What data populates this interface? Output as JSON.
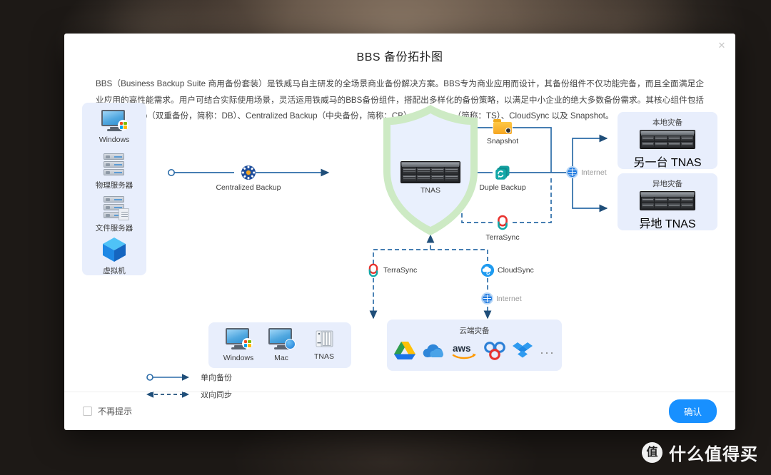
{
  "watermark": {
    "badge": "值",
    "text": "什么值得买"
  },
  "dialog": {
    "title": "BBS 备份拓扑图",
    "close_icon": "close-icon",
    "description": "BBS（Business Backup Suite 商用备份套装）是铁威马自主研发的全场景商业备份解决方案。BBS专为商业应用而设计，其备份组件不仅功能完备，而且全面满足企业应用的高性能需求。用户可结合实际使用场景，灵活运用铁威马的BBS备份组件，搭配出多样化的备份策略，以满足中小企业的绝大多数备份需求。其核心组件包括Duple Backup（双重备份，简称：DB）、Centralized Backup（中央备份，简称：CB）、TerraSync（简称：TS）、CloudSync 以及 Snapshot。"
  },
  "diagram": {
    "sources": [
      {
        "label": "Windows",
        "icon": "windows-monitor-icon"
      },
      {
        "label": "物理服务器",
        "icon": "physical-server-icon"
      },
      {
        "label": "文件服务器",
        "icon": "file-server-icon"
      },
      {
        "label": "虚拟机",
        "icon": "virtual-machine-cube-icon"
      }
    ],
    "centralized_backup": {
      "label": "Centralized Backup",
      "icon": "centralized-backup-icon"
    },
    "tnas": {
      "label": "TNAS",
      "icon": "rack-server-icon",
      "shield": "shield-shape"
    },
    "snapshot": {
      "label": "Snapshot",
      "icon": "snapshot-folder-icon"
    },
    "duple_backup": {
      "label": "Duple Backup",
      "icon": "duple-backup-icon"
    },
    "terrasync_top": {
      "label": "TerraSync",
      "icon": "terrasync-icon"
    },
    "internet_right": {
      "label": "Internet",
      "icon": "internet-globe-icon"
    },
    "local_dr": {
      "title": "本地灾备",
      "device": "另一台 TNAS",
      "icon": "rack-server-icon"
    },
    "remote_dr": {
      "title": "异地灾备",
      "device": "异地 TNAS",
      "icon": "rack-server-icon"
    },
    "terrasync_bottom": {
      "label": "TerraSync",
      "icon": "terrasync-icon"
    },
    "cloudsync": {
      "label": "CloudSync",
      "icon": "cloudsync-icon"
    },
    "internet_bottom": {
      "label": "Internet",
      "icon": "internet-globe-icon"
    },
    "endpoints": [
      {
        "label": "Windows",
        "icon": "windows-monitor-icon"
      },
      {
        "label": "Mac",
        "icon": "mac-monitor-icon"
      },
      {
        "label": "TNAS",
        "icon": "nas-tower-icon"
      }
    ],
    "cloud_panel": {
      "title": "云端灾备",
      "providers": [
        {
          "name": "google-drive-icon"
        },
        {
          "name": "onedrive-icon"
        },
        {
          "name": "aws-icon"
        },
        {
          "name": "baidu-cloud-icon"
        },
        {
          "name": "dropbox-icon"
        },
        {
          "name": "more-ellipsis"
        }
      ],
      "more_label": "···"
    }
  },
  "legend": [
    {
      "label": "单向备份",
      "style": "solid"
    },
    {
      "label": "双向同步",
      "style": "dashed"
    }
  ],
  "footer": {
    "no_prompt_label": "不再提示",
    "confirm_label": "确认"
  },
  "colors": {
    "accent": "#1890ff",
    "wire": "#2c6ca8",
    "panel_bg": "#e8eefc",
    "shield_green": "#cdeac4",
    "shield_inner": "#e9f0fd"
  }
}
